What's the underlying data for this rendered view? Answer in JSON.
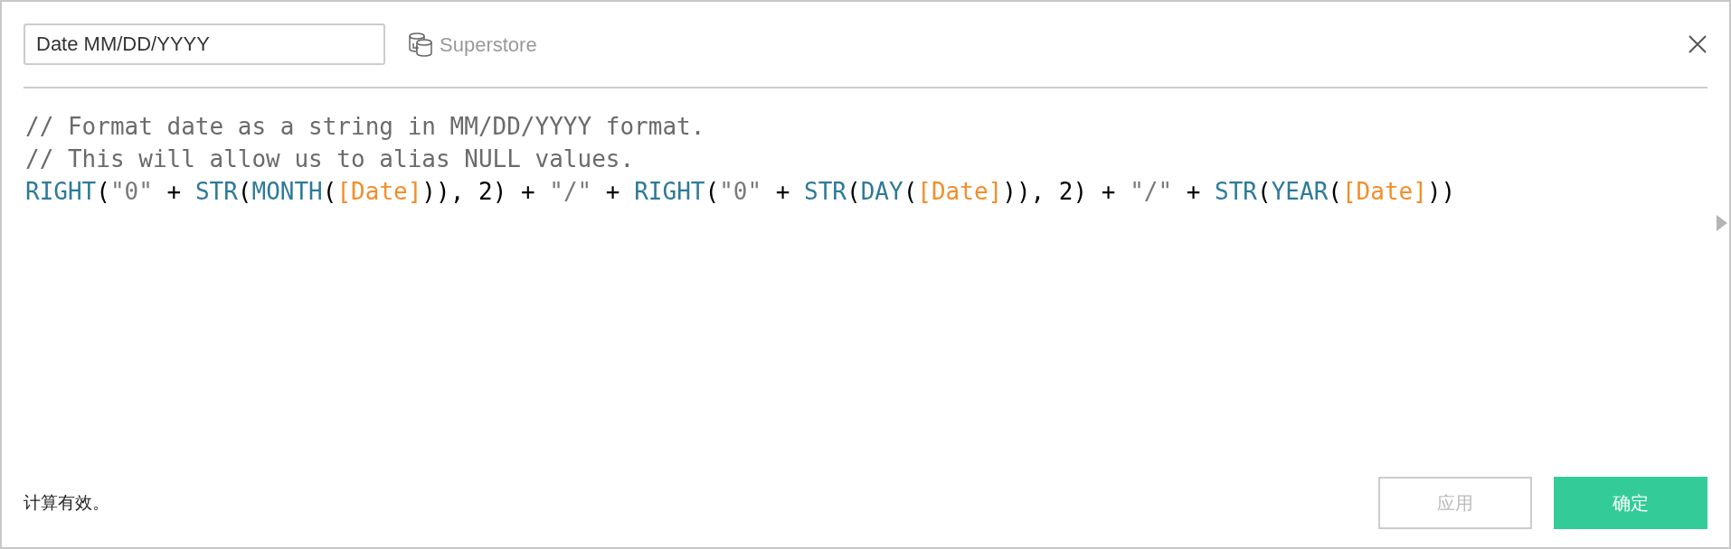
{
  "header": {
    "name_field": {
      "value": "Date MM/DD/YYYY"
    },
    "data_source": "Superstore"
  },
  "editor": {
    "lines": [
      [
        {
          "kind": "comment",
          "text": "// Format date as a string in MM/DD/YYYY format."
        }
      ],
      [
        {
          "kind": "comment",
          "text": "// This will allow us to alias NULL values."
        }
      ],
      [
        {
          "kind": "function",
          "text": "RIGHT"
        },
        {
          "kind": "plain",
          "text": "("
        },
        {
          "kind": "string",
          "text": "\"0\""
        },
        {
          "kind": "plain",
          "text": " + "
        },
        {
          "kind": "function",
          "text": "STR"
        },
        {
          "kind": "plain",
          "text": "("
        },
        {
          "kind": "function",
          "text": "MONTH"
        },
        {
          "kind": "plain",
          "text": "("
        },
        {
          "kind": "field",
          "text": "[Date]"
        },
        {
          "kind": "plain",
          "text": ")), 2) + "
        },
        {
          "kind": "string",
          "text": "\"/\""
        },
        {
          "kind": "plain",
          "text": " + "
        },
        {
          "kind": "function",
          "text": "RIGHT"
        },
        {
          "kind": "plain",
          "text": "("
        },
        {
          "kind": "string",
          "text": "\"0\""
        },
        {
          "kind": "plain",
          "text": " + "
        },
        {
          "kind": "function",
          "text": "STR"
        },
        {
          "kind": "plain",
          "text": "("
        },
        {
          "kind": "function",
          "text": "DAY"
        },
        {
          "kind": "plain",
          "text": "("
        },
        {
          "kind": "field",
          "text": "[Date]"
        },
        {
          "kind": "plain",
          "text": ")), 2) + "
        },
        {
          "kind": "string",
          "text": "\"/\""
        },
        {
          "kind": "plain",
          "text": " + "
        },
        {
          "kind": "function",
          "text": "STR"
        },
        {
          "kind": "plain",
          "text": "("
        },
        {
          "kind": "function",
          "text": "YEAR"
        },
        {
          "kind": "plain",
          "text": "("
        },
        {
          "kind": "field",
          "text": "[Date]"
        },
        {
          "kind": "plain",
          "text": "))"
        }
      ]
    ]
  },
  "footer": {
    "status": "计算有效。",
    "buttons": [
      {
        "label": "应用",
        "disabled": true,
        "kind": "secondary"
      },
      {
        "label": "确定",
        "disabled": false,
        "kind": "primary"
      }
    ]
  }
}
